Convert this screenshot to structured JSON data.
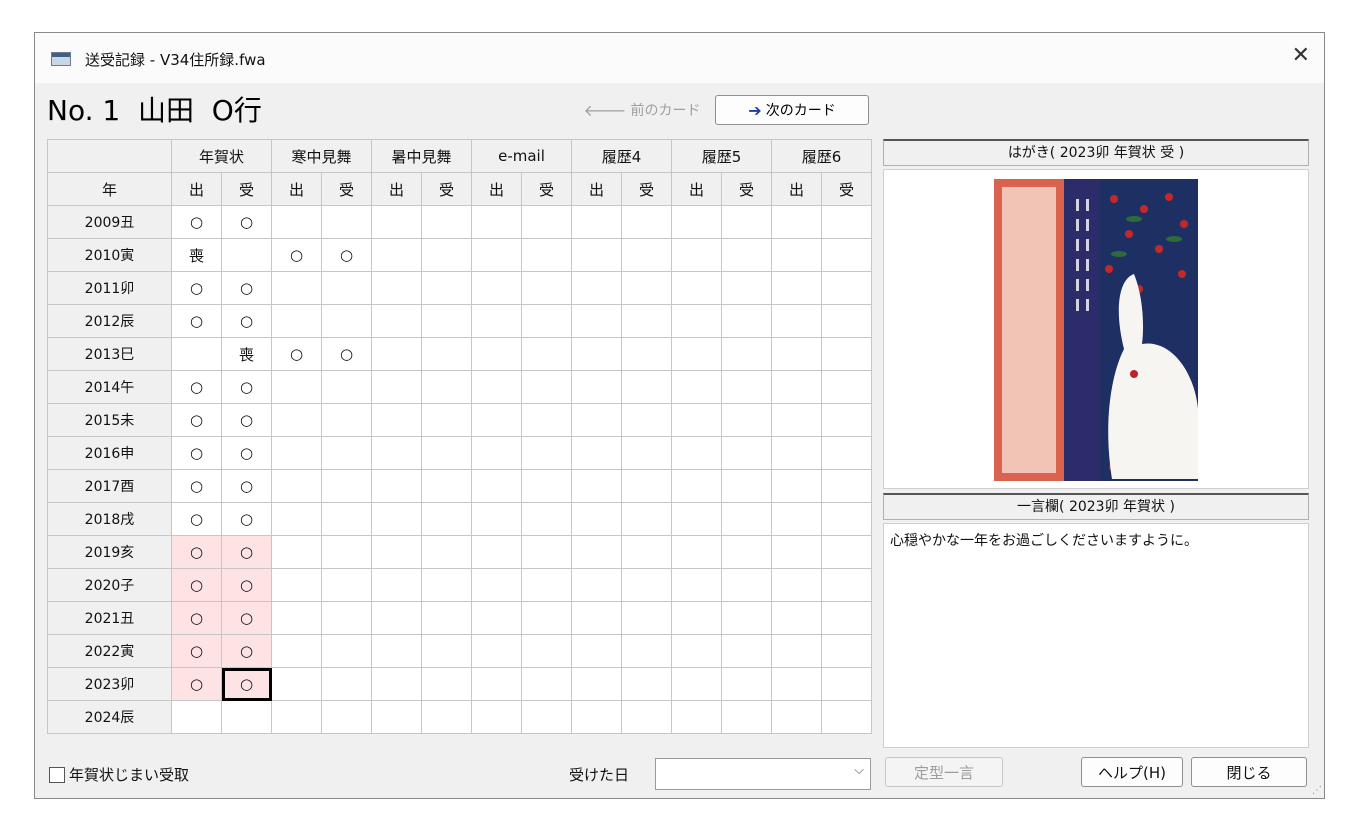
{
  "window": {
    "title": "送受記録 - V34住所録.fwa"
  },
  "heading": "No. 1  山田  O行",
  "nav": {
    "prev_label": "前のカード",
    "next_label": "次のカード"
  },
  "table": {
    "group_headers": [
      "",
      "年賀状",
      "寒中見舞",
      "暑中見舞",
      "e-mail",
      "履歴4",
      "履歴5",
      "履歴6"
    ],
    "sub_headers": [
      "年",
      "出",
      "受",
      "出",
      "受",
      "出",
      "受",
      "出",
      "受",
      "出",
      "受",
      "出",
      "受",
      "出",
      "受"
    ],
    "rows": [
      {
        "year": "2009丑",
        "cells": [
          "○",
          "○",
          "",
          "",
          "",
          "",
          "",
          "",
          "",
          "",
          "",
          "",
          "",
          ""
        ]
      },
      {
        "year": "2010寅",
        "cells": [
          "喪",
          "",
          "○",
          "○",
          "",
          "",
          "",
          "",
          "",
          "",
          "",
          "",
          "",
          ""
        ]
      },
      {
        "year": "2011卯",
        "cells": [
          "○",
          "○",
          "",
          "",
          "",
          "",
          "",
          "",
          "",
          "",
          "",
          "",
          "",
          ""
        ]
      },
      {
        "year": "2012辰",
        "cells": [
          "○",
          "○",
          "",
          "",
          "",
          "",
          "",
          "",
          "",
          "",
          "",
          "",
          "",
          ""
        ]
      },
      {
        "year": "2013巳",
        "cells": [
          "",
          "喪",
          "○",
          "○",
          "",
          "",
          "",
          "",
          "",
          "",
          "",
          "",
          "",
          ""
        ]
      },
      {
        "year": "2014午",
        "cells": [
          "○",
          "○",
          "",
          "",
          "",
          "",
          "",
          "",
          "",
          "",
          "",
          "",
          "",
          ""
        ]
      },
      {
        "year": "2015未",
        "cells": [
          "○",
          "○",
          "",
          "",
          "",
          "",
          "",
          "",
          "",
          "",
          "",
          "",
          "",
          ""
        ]
      },
      {
        "year": "2016申",
        "cells": [
          "○",
          "○",
          "",
          "",
          "",
          "",
          "",
          "",
          "",
          "",
          "",
          "",
          "",
          ""
        ]
      },
      {
        "year": "2017酉",
        "cells": [
          "○",
          "○",
          "",
          "",
          "",
          "",
          "",
          "",
          "",
          "",
          "",
          "",
          "",
          ""
        ]
      },
      {
        "year": "2018戌",
        "cells": [
          "○",
          "○",
          "",
          "",
          "",
          "",
          "",
          "",
          "",
          "",
          "",
          "",
          "",
          ""
        ]
      },
      {
        "year": "2019亥",
        "cells": [
          "○",
          "○",
          "",
          "",
          "",
          "",
          "",
          "",
          "",
          "",
          "",
          "",
          "",
          ""
        ]
      },
      {
        "year": "2020子",
        "cells": [
          "○",
          "○",
          "",
          "",
          "",
          "",
          "",
          "",
          "",
          "",
          "",
          "",
          "",
          ""
        ]
      },
      {
        "year": "2021丑",
        "cells": [
          "○",
          "○",
          "",
          "",
          "",
          "",
          "",
          "",
          "",
          "",
          "",
          "",
          "",
          ""
        ]
      },
      {
        "year": "2022寅",
        "cells": [
          "○",
          "○",
          "",
          "",
          "",
          "",
          "",
          "",
          "",
          "",
          "",
          "",
          "",
          ""
        ]
      },
      {
        "year": "2023卯",
        "cells": [
          "○",
          "○",
          "",
          "",
          "",
          "",
          "",
          "",
          "",
          "",
          "",
          "",
          "",
          ""
        ]
      },
      {
        "year": "2024辰",
        "cells": [
          "",
          "",
          "",
          "",
          "",
          "",
          "",
          "",
          "",
          "",
          "",
          "",
          "",
          ""
        ]
      }
    ],
    "highlight_color": "#fde3e4"
  },
  "image_panel": {
    "header": "はがき( 2023卯 年賀状 受 )"
  },
  "note_panel": {
    "header": "一言欄( 2023卯 年賀状 )",
    "text": "心穏やかな一年をお過ごしくださいますように。"
  },
  "footer": {
    "checkbox_label": "年賀状じまい受取",
    "date_label": "受けた日",
    "date_value": "",
    "fixed_phrase_button": "定型一言",
    "help_button": "ヘルプ(H)",
    "close_button": "閉じる"
  }
}
